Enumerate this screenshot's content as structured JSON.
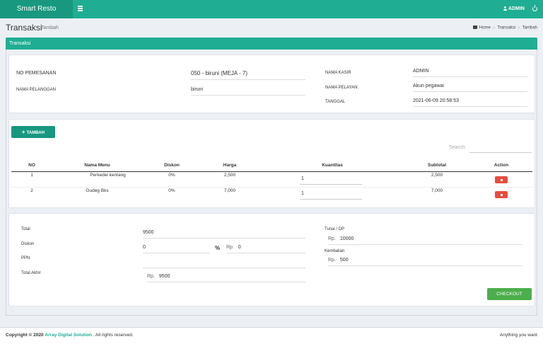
{
  "header": {
    "brand": "Smart Resto",
    "user": "ADMIN",
    "user_icon": "user-icon",
    "menu_icon": "hamburger-icon",
    "logout_icon": "power-icon"
  },
  "page": {
    "title": "Transaksi",
    "subtitle": "Tambah",
    "breadcrumb": [
      "Home",
      "Transaksi",
      "Tambah"
    ],
    "section": "Transaksi"
  },
  "order": {
    "no_pemesanan_label": "NO PEMESANAN",
    "no_pemesanan_value": "050 - biruni (MEJA - 7)",
    "nama_pelanggan_label": "NAMA PELANGGAN",
    "nama_pelanggan_value": "biruni",
    "nama_kasir_label": "NAMA KASIR",
    "nama_kasir_value": "ADMIN",
    "nama_pelayan_label": "NAMA PELAYAN:",
    "nama_pelayan_value": "Akun pegawai",
    "tanggal_label": "TANGGAL",
    "tanggal_value": "2021-06-09 20:58:53"
  },
  "table": {
    "add_label": "TAMBAH",
    "search_label": "Search:",
    "columns": [
      "NO",
      "Nama Menu",
      "Diskon",
      "Harga",
      "Kuantitas",
      "Subtotal",
      "Action"
    ],
    "rows": [
      {
        "no": "1",
        "menu": "Perkedel kentang",
        "diskon": "0%",
        "harga": "2,500",
        "qty": "1",
        "subtotal": "2,500"
      },
      {
        "no": "2",
        "menu": "Gudeg Bks",
        "diskon": "0%",
        "harga": "7,000",
        "qty": "1",
        "subtotal": "7,000"
      }
    ],
    "delete_icon": "trash-icon",
    "delete_color": "#e74c3c"
  },
  "summary": {
    "total_label": "Total",
    "total_value": "9500",
    "diskon_label": "Diskon",
    "diskon_value": "0",
    "percent": "%",
    "rp": "Rp.",
    "diskon_rp_value": "0",
    "ppn_label": "PPN",
    "ppn_value": "",
    "total_akhir_label": "Total Akhir",
    "total_akhir_value": "9500",
    "tunai_label": "Tunai / DP",
    "tunai_value": "10000",
    "kembalian_label": "Kembalian",
    "kembalian_value": "500",
    "checkout_label": "CHECKOUT"
  },
  "footer": {
    "copyright": "Copyright © 2020",
    "company": "Array Digital Solution",
    "rights": ". All rights reserved.",
    "tagline": "Anything you want"
  },
  "colors": {
    "primary": "#1fae93",
    "primary_dark": "#17987f",
    "success": "#4cae4c",
    "danger": "#e74c3c"
  }
}
